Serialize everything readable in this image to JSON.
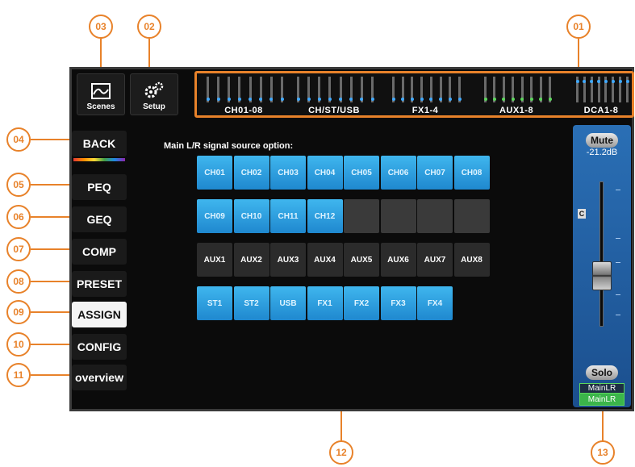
{
  "callouts": [
    "01",
    "02",
    "03",
    "04",
    "05",
    "06",
    "07",
    "08",
    "09",
    "10",
    "11",
    "12",
    "13"
  ],
  "top": {
    "scenes_label": "Scenes",
    "setup_label": "Setup",
    "meter_groups": [
      {
        "label": "CH01-08",
        "dot_color": "#3fa9ff"
      },
      {
        "label": "CH/ST/USB",
        "dot_color": "#3fa9ff"
      },
      {
        "label": "FX1-4",
        "dot_color": "#3fa9ff"
      },
      {
        "label": "AUX1-8",
        "dot_color": "#5cd65c"
      },
      {
        "label": "DCA1-8",
        "dot_color": "#3fa9ff"
      }
    ]
  },
  "side_menu": [
    {
      "label": "BACK",
      "active": false
    },
    {
      "label": "PEQ",
      "active": false
    },
    {
      "label": "GEQ",
      "active": false
    },
    {
      "label": "COMP",
      "active": false
    },
    {
      "label": "PRESET",
      "active": false
    },
    {
      "label": "ASSIGN",
      "active": true
    },
    {
      "label": "CONFIG",
      "active": false
    },
    {
      "label": "overview",
      "active": false
    }
  ],
  "main": {
    "prompt": "Main L/R signal source option:",
    "rows": [
      [
        {
          "label": "CH01",
          "state": "on"
        },
        {
          "label": "CH02",
          "state": "on"
        },
        {
          "label": "CH03",
          "state": "on"
        },
        {
          "label": "CH04",
          "state": "on"
        },
        {
          "label": "CH05",
          "state": "on"
        },
        {
          "label": "CH06",
          "state": "on"
        },
        {
          "label": "CH07",
          "state": "on"
        },
        {
          "label": "CH08",
          "state": "on"
        }
      ],
      [
        {
          "label": "CH09",
          "state": "on"
        },
        {
          "label": "CH10",
          "state": "on"
        },
        {
          "label": "CH11",
          "state": "on"
        },
        {
          "label": "CH12",
          "state": "on"
        },
        {
          "label": "",
          "state": "empty"
        },
        {
          "label": "",
          "state": "empty"
        },
        {
          "label": "",
          "state": "empty"
        },
        {
          "label": "",
          "state": "empty"
        }
      ],
      [
        {
          "label": "AUX1",
          "state": "off"
        },
        {
          "label": "AUX2",
          "state": "off"
        },
        {
          "label": "AUX3",
          "state": "off"
        },
        {
          "label": "AUX4",
          "state": "off"
        },
        {
          "label": "AUX5",
          "state": "off"
        },
        {
          "label": "AUX6",
          "state": "off"
        },
        {
          "label": "AUX7",
          "state": "off"
        },
        {
          "label": "AUX8",
          "state": "off"
        }
      ],
      [
        {
          "label": "ST1",
          "state": "on"
        },
        {
          "label": "ST2",
          "state": "on"
        },
        {
          "label": "USB",
          "state": "on"
        },
        {
          "label": "FX1",
          "state": "on"
        },
        {
          "label": "FX2",
          "state": "on"
        },
        {
          "label": "FX3",
          "state": "on"
        },
        {
          "label": "FX4",
          "state": "on"
        }
      ]
    ]
  },
  "fader": {
    "mute_label": "Mute",
    "gain_readout": "-21.2dB",
    "center_mark": "C",
    "solo_label": "Solo",
    "assign_top": "MainLR",
    "assign_bottom": "MainLR",
    "level": 0.35,
    "colors": {
      "panel": "#2a6fb5",
      "assign_active": "#3bb54a"
    }
  }
}
